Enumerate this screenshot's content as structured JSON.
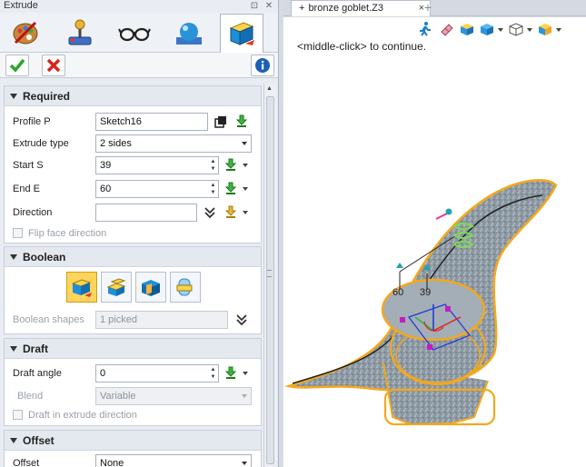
{
  "panel": {
    "title": "Extrude",
    "pin_glyph": "⊡",
    "close_glyph": "✕",
    "tabs": [
      {
        "icon": "palette-icon",
        "active": false
      },
      {
        "icon": "joystick-icon",
        "active": false
      },
      {
        "icon": "glasses-icon",
        "active": false
      },
      {
        "icon": "sphere-render-icon",
        "active": false
      },
      {
        "icon": "extrude-box-icon",
        "active": true
      }
    ],
    "actions": {
      "ok_icon": "checkmark-icon",
      "cancel_icon": "x-icon",
      "info_icon": "info-icon"
    }
  },
  "required": {
    "header": "Required",
    "profile": {
      "label": "Profile P",
      "value": "Sketch16"
    },
    "extrude_type": {
      "label": "Extrude type",
      "value": "2 sides"
    },
    "start": {
      "label": "Start S",
      "value": "39"
    },
    "end": {
      "label": "End E",
      "value": "60"
    },
    "direction": {
      "label": "Direction",
      "value": ""
    },
    "flip": {
      "label": "Flip face direction"
    }
  },
  "boolean": {
    "header": "Boolean",
    "shapes_label": "Boolean shapes",
    "shapes_value": "1 picked"
  },
  "draft": {
    "header": "Draft",
    "angle": {
      "label": "Draft angle",
      "value": "0"
    },
    "blend": {
      "label": "Blend",
      "value": "Variable"
    },
    "extrude_dir": {
      "label": "Draft in extrude direction"
    }
  },
  "offset": {
    "header": "Offset",
    "offset": {
      "label": "Offset",
      "value": "None"
    }
  },
  "document": {
    "tab_prefix": "+",
    "tab_label": "bronze goblet.Z3",
    "tab_close": "×",
    "new_tab": "+",
    "hint": "<middle-click> to continue.",
    "dims": {
      "a": "60",
      "b": "39"
    }
  }
}
